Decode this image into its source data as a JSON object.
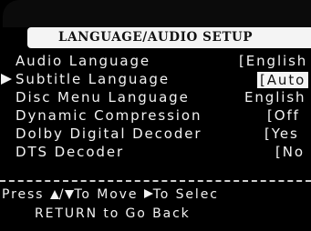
{
  "menu": {
    "title": "LANGUAGE/AUDIO SETUP",
    "items": [
      {
        "label": "Audio Language",
        "value": "[English"
      },
      {
        "label": "Subtitle Language",
        "value": "[Auto"
      },
      {
        "label": "Disc Menu Language",
        "value": "English"
      },
      {
        "label": "Dynamic Compression",
        "value": "[Off"
      },
      {
        "label": "Dolby Digital Decoder",
        "value": "[Yes"
      },
      {
        "label": "DTS Decoder",
        "value": "[No"
      }
    ],
    "selected_index": 1
  },
  "help": {
    "line1_prefix": "Press ",
    "line1_slash": "/",
    "line1_move": "To Move ",
    "line1_select": "To Selec",
    "line2": "RETURN to Go Back"
  },
  "icons": {
    "selection": "play-triangle-icon",
    "up": "triangle-up-icon",
    "down": "triangle-down-icon",
    "right": "triangle-right-icon"
  },
  "colors": {
    "background": "#000000",
    "foreground": "#f2f2f2",
    "highlight": "#f4f4f4",
    "highlight_text": "#111111"
  }
}
